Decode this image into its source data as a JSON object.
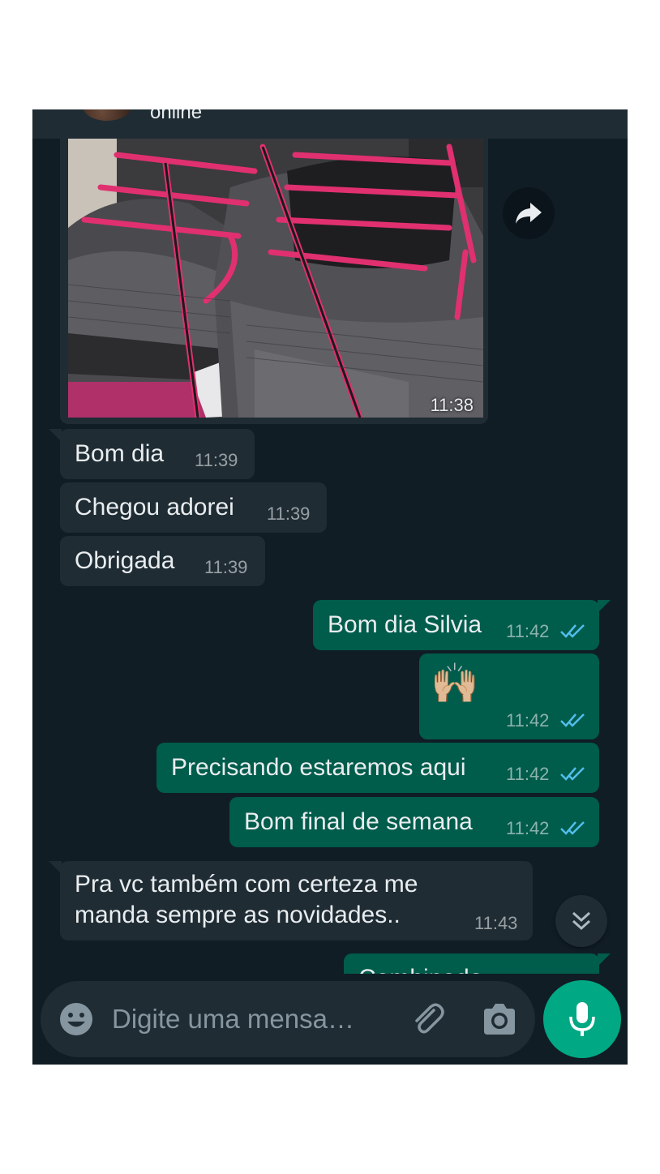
{
  "header": {
    "status": "online"
  },
  "messages": [
    {
      "type": "image",
      "direction": "incoming",
      "time": "11:38"
    },
    {
      "type": "text",
      "direction": "incoming",
      "text": "Bom dia",
      "time": "11:39"
    },
    {
      "type": "text",
      "direction": "incoming",
      "text": "Chegou adorei",
      "time": "11:39"
    },
    {
      "type": "text",
      "direction": "incoming",
      "text": "Obrigada",
      "time": "11:39"
    },
    {
      "type": "text",
      "direction": "outgoing",
      "text": "Bom dia Silvia",
      "time": "11:42",
      "read": true
    },
    {
      "type": "emoji",
      "direction": "outgoing",
      "text": "🙌🏼",
      "time": "11:42",
      "read": true
    },
    {
      "type": "text",
      "direction": "outgoing",
      "text": "Precisando estaremos aqui",
      "time": "11:42",
      "read": true
    },
    {
      "type": "text",
      "direction": "outgoing",
      "text": "Bom final de semana",
      "time": "11:42",
      "read": true
    },
    {
      "type": "text",
      "direction": "incoming",
      "lines": [
        "Pra vc também  com certeza me",
        "manda sempre as novidades.."
      ],
      "time": "11:43"
    },
    {
      "type": "text",
      "direction": "outgoing",
      "text": "Combinado",
      "partial": true
    }
  ],
  "composer": {
    "placeholder": "Digite uma mensa…"
  },
  "icons": {
    "forward": "forward-icon",
    "scroll_down": "chevron-double-down-icon",
    "emoji": "smiley-icon",
    "attach": "paperclip-icon",
    "camera": "camera-icon",
    "mic": "microphone-icon",
    "read": "double-check-icon"
  },
  "colors": {
    "background": "#101d25",
    "incoming_bubble": "#1f2c34",
    "outgoing_bubble": "#005c4b",
    "read_tick": "#53bdeb",
    "mic_button": "#00a884"
  }
}
